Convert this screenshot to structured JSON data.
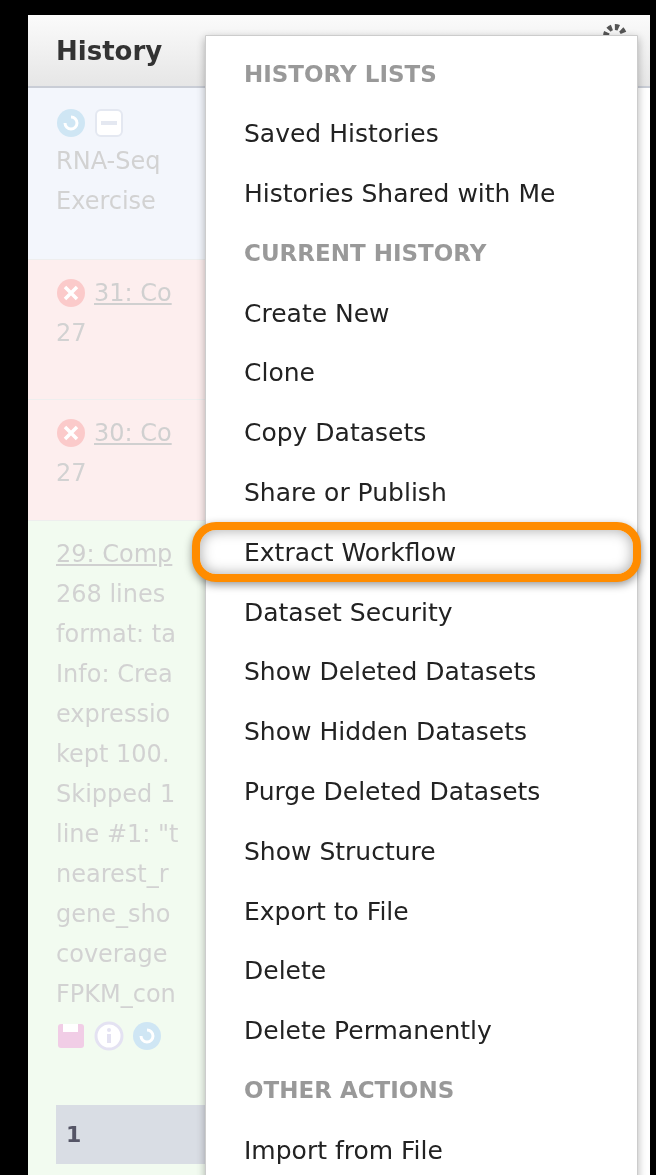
{
  "panel": {
    "title": "History"
  },
  "datasets": [
    {
      "kind": "current",
      "lines": [
        "RNA-Seq",
        "Exercise"
      ]
    },
    {
      "kind": "error",
      "title": "31: Co",
      "lines": [
        "27"
      ]
    },
    {
      "kind": "error",
      "title": "30: Co",
      "lines": [
        "27"
      ]
    },
    {
      "kind": "ok",
      "title": "29: Comp",
      "lines": [
        "268 lines",
        "format: ta",
        "Info: Crea",
        "expressio",
        "kept 100.",
        "Skipped 1",
        "line #1: \"t",
        "nearest_r",
        "gene_sho",
        "coverage",
        "FPKM_con"
      ],
      "peek": "1"
    }
  ],
  "menu": [
    {
      "kind": "header",
      "label": "HISTORY LISTS"
    },
    {
      "kind": "item",
      "label": "Saved Histories",
      "highlighted": false
    },
    {
      "kind": "item",
      "label": "Histories Shared with Me",
      "highlighted": false
    },
    {
      "kind": "header",
      "label": "CURRENT HISTORY"
    },
    {
      "kind": "item",
      "label": "Create New",
      "highlighted": false
    },
    {
      "kind": "item",
      "label": "Clone",
      "highlighted": false
    },
    {
      "kind": "item",
      "label": "Copy Datasets",
      "highlighted": false
    },
    {
      "kind": "item",
      "label": "Share or Publish",
      "highlighted": false
    },
    {
      "kind": "item",
      "label": "Extract Workflow",
      "highlighted": true
    },
    {
      "kind": "item",
      "label": "Dataset Security",
      "highlighted": false
    },
    {
      "kind": "item",
      "label": "Show Deleted Datasets",
      "highlighted": false
    },
    {
      "kind": "item",
      "label": "Show Hidden Datasets",
      "highlighted": false
    },
    {
      "kind": "item",
      "label": "Purge Deleted Datasets",
      "highlighted": false
    },
    {
      "kind": "item",
      "label": "Show Structure",
      "highlighted": false
    },
    {
      "kind": "item",
      "label": "Export to File",
      "highlighted": false
    },
    {
      "kind": "item",
      "label": "Delete",
      "highlighted": false
    },
    {
      "kind": "item",
      "label": "Delete Permanently",
      "highlighted": false
    },
    {
      "kind": "header",
      "label": "OTHER ACTIONS"
    },
    {
      "kind": "item",
      "label": "Import from File",
      "highlighted": false
    }
  ]
}
